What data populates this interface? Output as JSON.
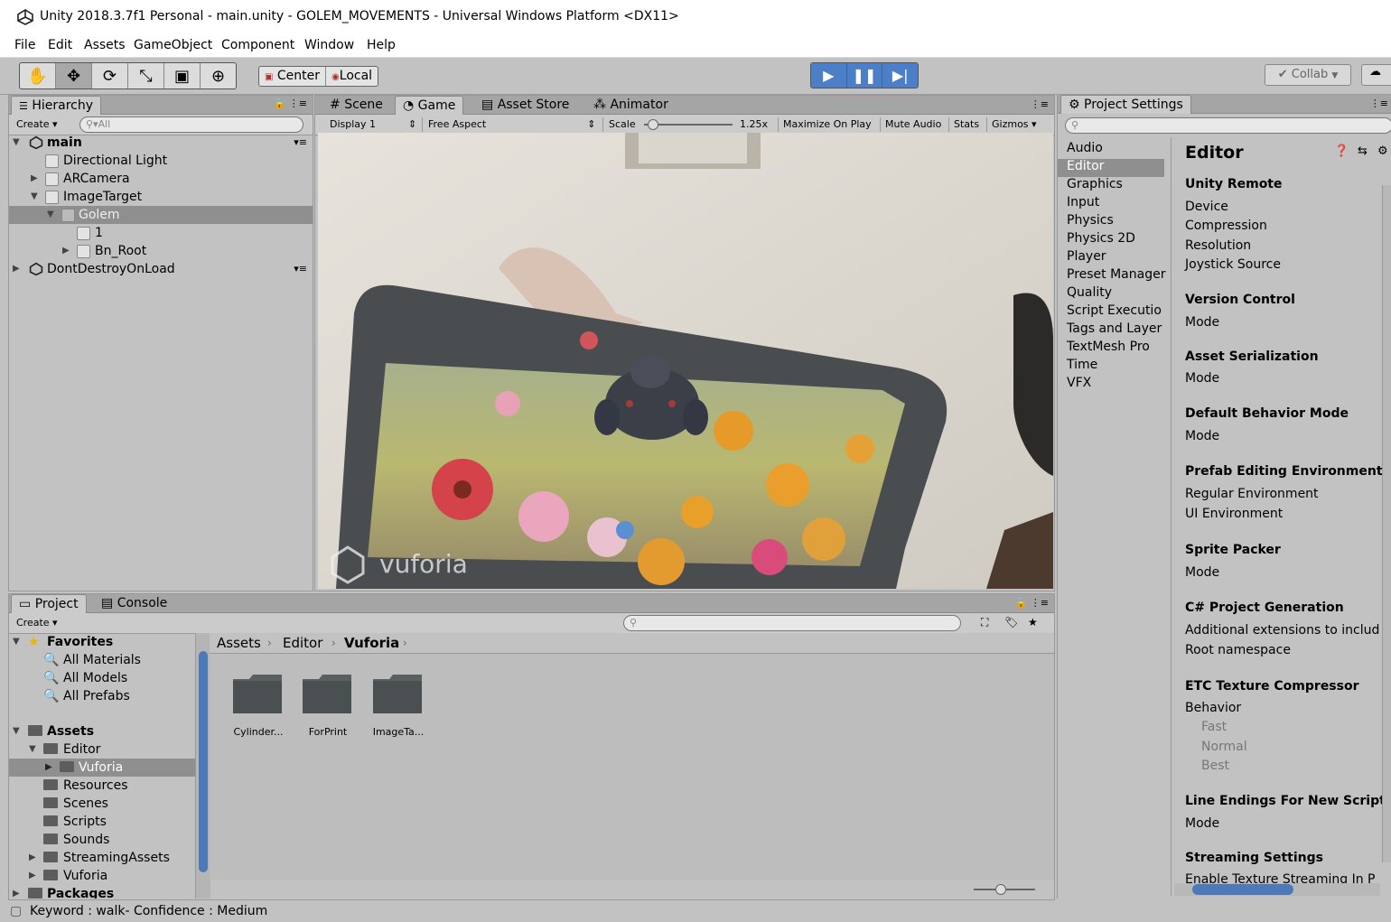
{
  "window": {
    "title": "Unity 2018.3.7f1 Personal - main.unity - GOLEM_MOVEMENTS - Universal Windows Platform <DX11>"
  },
  "menu": [
    "File",
    "Edit",
    "Assets",
    "GameObject",
    "Component",
    "Window",
    "Help"
  ],
  "toolbar": {
    "center_label": "Center",
    "local_label": "Local",
    "collab_label": "Collab"
  },
  "hierarchy": {
    "tab_label": "Hierarchy",
    "create_label": "Create",
    "search_placeholder": "All",
    "items": [
      {
        "label": "main",
        "bold": true
      },
      {
        "label": "Directional Light"
      },
      {
        "label": "ARCamera"
      },
      {
        "label": "ImageTarget"
      },
      {
        "label": "Golem",
        "selected": true
      },
      {
        "label": "1"
      },
      {
        "label": "Bn_Root"
      },
      {
        "label": "DontDestroyOnLoad"
      }
    ]
  },
  "center_tabs": {
    "scene": "Scene",
    "game": "Game",
    "asset_store": "Asset Store",
    "animator": "Animator"
  },
  "game_bar": {
    "display": "Display 1",
    "aspect": "Free Aspect",
    "scale_label": "Scale",
    "scale_value": "1.25x",
    "scale_fraction": 0.05,
    "maximize": "Maximize On Play",
    "mute": "Mute Audio",
    "stats": "Stats",
    "gizmos": "Gizmos"
  },
  "game_view": {
    "watermark": "vuforia"
  },
  "project": {
    "tab_project": "Project",
    "tab_console": "Console",
    "create_label": "Create",
    "favorites_label": "Favorites",
    "favorites": [
      "All Materials",
      "All Models",
      "All Prefabs"
    ],
    "assets_label": "Assets",
    "assets_tree": [
      "Editor",
      "Vuforia",
      "Resources",
      "Scenes",
      "Scripts",
      "Sounds",
      "StreamingAssets",
      "Vuforia"
    ],
    "packages_label": "Packages",
    "breadcrumb": [
      "Assets",
      "Editor",
      "Vuforia"
    ],
    "folders": [
      "Cylinder...",
      "ForPrint",
      "ImageTa..."
    ]
  },
  "settings": {
    "tab_label": "Project Settings",
    "categories": [
      "Audio",
      "Editor",
      "Graphics",
      "Input",
      "Physics",
      "Physics 2D",
      "Player",
      "Preset Manager",
      "Quality",
      "Script Executio",
      "Tags and Layer",
      "TextMesh Pro",
      "Time",
      "VFX"
    ],
    "selected_category": "Editor",
    "title": "Editor",
    "sections": {
      "unity_remote": "Unity Remote",
      "device": "Device",
      "compression": "Compression",
      "resolution": "Resolution",
      "joystick": "Joystick Source",
      "version_control": "Version Control",
      "vc_mode": "Mode",
      "asset_serialization": "Asset Serialization",
      "as_mode": "Mode",
      "default_behavior": "Default Behavior Mode",
      "db_mode": "Mode",
      "prefab_editing": "Prefab Editing Environments",
      "regular_env": "Regular Environment",
      "ui_env": "UI Environment",
      "sprite_packer": "Sprite Packer",
      "sp_mode": "Mode",
      "csharp_gen": "C# Project Generation",
      "additional_ext": "Additional extensions to includ",
      "root_ns": "Root namespace",
      "etc_compressor": "ETC Texture Compressor",
      "behavior": "Behavior",
      "fast": "Fast",
      "normal": "Normal",
      "best": "Best",
      "line_endings": "Line Endings For New Script",
      "le_mode": "Mode",
      "streaming": "Streaming Settings",
      "enable_streaming": "Enable Texture Streaming In P"
    }
  },
  "status": {
    "text": "Keyword : walk- Confidence : Medium"
  },
  "colors": {
    "panel": "#c2c2c2",
    "selection": "#8f8f8f",
    "play_blue": "#4c7fc8"
  }
}
